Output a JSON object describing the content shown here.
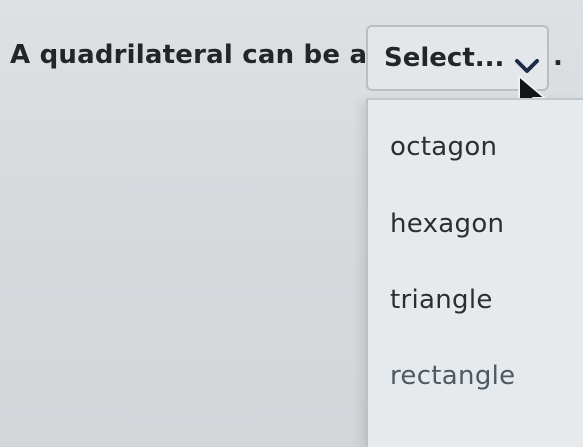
{
  "question": {
    "prompt": "A quadrilateral can be a",
    "trailing_punctuation": "."
  },
  "select": {
    "placeholder": "Select...",
    "icon": "chevron-down-icon",
    "expanded": true,
    "options": [
      {
        "label": "octagon"
      },
      {
        "label": "hexagon"
      },
      {
        "label": "triangle"
      },
      {
        "label": "rectangle"
      }
    ]
  },
  "colors": {
    "background": "#d8dcdf",
    "text": "#22262a",
    "dropdown_bg": "#e7eaec",
    "chevron": "#1e2a4a"
  }
}
